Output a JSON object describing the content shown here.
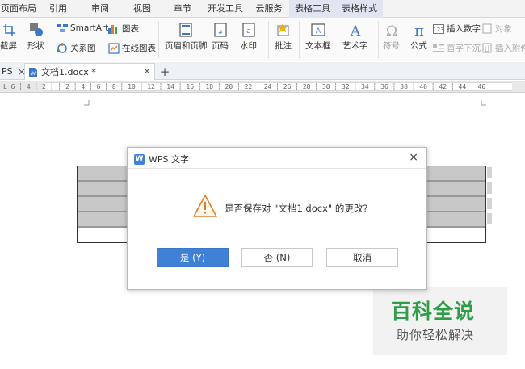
{
  "menu_tabs": [
    {
      "label": "页面布局",
      "active": false
    },
    {
      "label": "引用",
      "active": false
    },
    {
      "label": "审阅",
      "active": false
    },
    {
      "label": "视图",
      "active": false
    },
    {
      "label": "章节",
      "active": false
    },
    {
      "label": "开发工具",
      "active": false
    },
    {
      "label": "云服务",
      "active": false
    },
    {
      "label": "表格工具",
      "active": true
    },
    {
      "label": "表格样式",
      "active": true
    }
  ],
  "ribbon": {
    "screenshot": "截屏",
    "shapes": "形状",
    "smartart": "SmartArt",
    "chart": "图表",
    "relation_chart": "关系图",
    "online_chart": "在线图表",
    "header_footer": "页眉和页脚",
    "page_number": "页码",
    "watermark": "水印",
    "comment": "批注",
    "textbox": "文本框",
    "wordart": "艺术字",
    "symbol": "符号",
    "formula": "公式",
    "insert_number": "插入数字",
    "object": "对象",
    "drop_cap": "首字下沉",
    "insert_attachment": "插入附件"
  },
  "doc_tabs": {
    "left_stub": "PS",
    "active_tab": "文档1.docx *",
    "close_glyph": "×",
    "new_tab_glyph": "+"
  },
  "ruler": {
    "text": "L 6 ┆ 4 ┆ 2 ┆   ┆ 2 ┆ 4 ┆ 6 ┆ 8 ┆ 10 ┆ 12 ┆ 14 ┆ 16 ┆ 18 ┆ 20 ┆ 22 ┆ 24 ┆ 26 ┆ 28 ┆ 30 ┆ 32 ┆ 34 ┆ 36 ┆ 38 ┆ 40 ┆ 42 ┆ 44 ┆ 46"
  },
  "dialog": {
    "app_icon_letter": "W",
    "title": "WPS 文字",
    "close_glyph": "×",
    "message": "是否保存对 \"文档1.docx\" 的更改?",
    "yes": "是 (Y)",
    "no": "否 (N)",
    "cancel": "取消"
  },
  "watermark": {
    "title": "百科全说",
    "subtitle": "助你轻松解决"
  },
  "colors": {
    "primary_button": "#3e81d6",
    "warning_icon": "#e07c2a",
    "watermark_green": "#2f9c48"
  }
}
